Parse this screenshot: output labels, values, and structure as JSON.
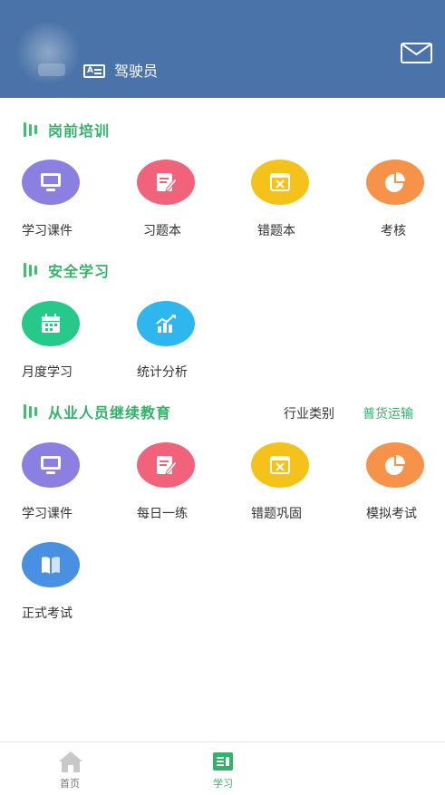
{
  "header": {
    "role_label": "驾驶员",
    "icons": {
      "role": "id-card-icon",
      "mail": "mail-icon"
    }
  },
  "sections": {
    "onboarding": {
      "title": "岗前培训",
      "items": [
        {
          "label": "学习课件",
          "icon": "monitor-icon",
          "color": "#8b7fe2"
        },
        {
          "label": "习题本",
          "icon": "edit-note-icon",
          "color": "#f0637a"
        },
        {
          "label": "错题本",
          "icon": "wrong-book-icon",
          "color": "#f5c21b"
        },
        {
          "label": "考核",
          "icon": "pie-chart-icon",
          "color": "#f7924a"
        }
      ]
    },
    "safety": {
      "title": "安全学习",
      "items": [
        {
          "label": "月度学习",
          "icon": "calendar-icon",
          "color": "#27c98a"
        },
        {
          "label": "统计分析",
          "icon": "bar-chart-icon",
          "color": "#2fb6ef"
        }
      ]
    },
    "continuing": {
      "title": "从业人员继续教育",
      "industry_label": "行业类别",
      "industry_value": "普货运输",
      "items": [
        {
          "label": "学习课件",
          "icon": "monitor-icon",
          "color": "#8b7fe2"
        },
        {
          "label": "每日一练",
          "icon": "edit-note-icon",
          "color": "#f0637a"
        },
        {
          "label": "错题巩固",
          "icon": "wrong-book-icon",
          "color": "#f5c21b"
        },
        {
          "label": "模拟考试",
          "icon": "pie-chart-icon",
          "color": "#f7924a"
        },
        {
          "label": "正式考试",
          "icon": "book-icon",
          "color": "#4a90e2"
        }
      ]
    }
  },
  "tabbar": {
    "tabs": [
      {
        "label": "首页",
        "icon": "home-icon",
        "active": false
      },
      {
        "label": "学习",
        "icon": "study-icon",
        "active": true
      }
    ],
    "colors": {
      "active": "#33b36a",
      "inactive": "#777777",
      "inactive_icon": "#c8c8c8"
    }
  },
  "colors": {
    "header_bg": "#4a74a9",
    "accent_green": "#33b36a"
  }
}
